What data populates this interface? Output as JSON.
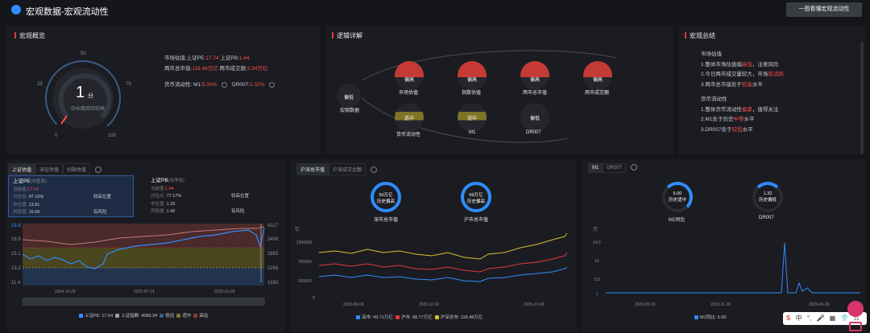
{
  "header": {
    "title": "宏观数据-宏观流动性",
    "cta": "一图看懂宏观流动性"
  },
  "overview": {
    "title": "宏观概览",
    "score": "1",
    "score_unit": "分",
    "score_desc": "中长期风险较高",
    "ticks": [
      "0",
      "25",
      "50",
      "75",
      "100"
    ],
    "line1_prefix": "市场估值:上证PE:",
    "pe": "17.74",
    "line1_mid": "上证PB:",
    "pb": "1.44",
    "line2_prefix": "两市总市值:",
    "mcap": "118.48万亿",
    "line2_mid": "两市成交额:",
    "turnover": "3.34万亿",
    "line3_prefix": "货币流动性: M1:",
    "m1": "5.00%",
    "line3_mid": "DR007:",
    "dr007": "1.32%"
  },
  "logic": {
    "title": "逻辑详解",
    "center_label": "宏观数据",
    "center_badge": "偏低",
    "top_nodes": [
      {
        "badge": "偏高",
        "label": "市场估值"
      },
      {
        "badge": "偏高",
        "label": "指数估值"
      },
      {
        "badge": "偏高",
        "label": "两市总市值"
      },
      {
        "badge": "偏高",
        "label": "两市成交额"
      }
    ],
    "bottom_nodes": [
      {
        "badge": "适中",
        "label": "货币流动性"
      },
      {
        "badge": "适中",
        "label": "M1"
      },
      {
        "badge": "偏低",
        "label": "DR007"
      }
    ]
  },
  "summary": {
    "title": "宏观总结",
    "sec1": "市场估值",
    "s1a_pre": "1.整体市场估值偏",
    "s1a_hl": "高估",
    "s1a_post": "，注意风险",
    "s1b_pre": "2.今日两市成交量较大，市场",
    "s1b_hl": "较活跃",
    "s1c_pre": "3.两市总市值处于",
    "s1c_hl": "较高",
    "s1c_post": "水平",
    "sec2": "货币流动性",
    "s2a_pre": "1.整体货币流动性",
    "s2a_hl": "偏紧",
    "s2a_post": "，值得关注",
    "s2b_pre": "2.M1处于历史",
    "s2b_hl": "中等",
    "s2b_post": "水平",
    "s2c_pre": "3.DR007处于",
    "s2c_hl": "较低",
    "s2c_post": "水平"
  },
  "valuation": {
    "tabs": [
      "上证估值",
      "深证估值",
      "创指估值"
    ],
    "pe_card": {
      "title": "上证PE",
      "title_sub": "(市盈率)",
      "cur_label": "当前值:",
      "cur": "17.74",
      "pct_label": "分位点:",
      "pct": "97.16%",
      "pos": "较高位置",
      "mid_label": "中位值:",
      "mid": "13.81",
      "risk_label": "风险值:",
      "risk": "15.69",
      "risk_tag": "有风险"
    },
    "pb_card": {
      "title": "上证PB",
      "title_sub": "(市净率)",
      "cur_label": "当前值:",
      "cur": "1.44",
      "pct_label": "分位点:",
      "pct": "77.17%",
      "pos": "较高位置",
      "mid_label": "中位值:",
      "mid": "1.29",
      "risk_label": "风险值:",
      "risk": "1.40",
      "risk_tag": "有风险"
    },
    "y_left": [
      "18.8",
      "16.9",
      "15.1",
      "13.2",
      "11.4"
    ],
    "y_right": [
      "4117",
      "3499",
      "2883",
      "2266",
      "1650"
    ],
    "x_labels": [
      "2024-10-25",
      "2025-07-14",
      "2025-01-29"
    ],
    "legend": [
      {
        "label": "上证PE: 17.54",
        "color": "#2f8cff"
      },
      {
        "label": "上证指数: 4086.34",
        "color": "#9aa0aa"
      },
      {
        "label": "低估",
        "color": "#3a5a88"
      },
      {
        "label": "适中",
        "color": "#807a2e"
      },
      {
        "label": "高估",
        "color": "#8b3b3b"
      }
    ]
  },
  "market": {
    "tabs": [
      "沪深总市值",
      "沪深成交金额"
    ],
    "ring1": {
      "value": "50万亿",
      "desc": "历史偏高",
      "label": "深市总市值"
    },
    "ring2": {
      "value": "69万亿",
      "desc": "历史偏高",
      "label": "沪市总市值"
    },
    "y_unit": "亿",
    "y_labels": [
      "1000000",
      "750000",
      "500000",
      "250000",
      "0"
    ],
    "x_labels": [
      "2023-06-06",
      "2023-11-02",
      "2025-07-09"
    ],
    "legend": [
      {
        "label": "深市: 49.71万亿",
        "color": "#2f8cff"
      },
      {
        "label": "沪市: 68.77万亿",
        "color": "#e0393b"
      },
      {
        "label": "沪深总市: 118.48万亿",
        "color": "#d8c02f"
      }
    ]
  },
  "money": {
    "tabs": [
      "M1",
      "DR007"
    ],
    "ring1": {
      "value": "5.00",
      "desc": "历史适中",
      "label": "M1同比"
    },
    "ring2": {
      "value": "1.32",
      "desc": "历史偏低",
      "label": "DR007"
    },
    "y_unit": "万",
    "y_labels": [
      "14.5",
      "10",
      "5.5",
      "1"
    ],
    "x_labels": [
      "2023-05-31",
      "2023-11-30",
      "2025-06-30"
    ],
    "legend": [
      {
        "label": "M1同比: 5.00",
        "color": "#2f8cff"
      }
    ]
  },
  "float_bar": {
    "items": [
      "S",
      "中",
      "°,",
      "🎤",
      "▦",
      "👕",
      "⚏"
    ]
  }
}
